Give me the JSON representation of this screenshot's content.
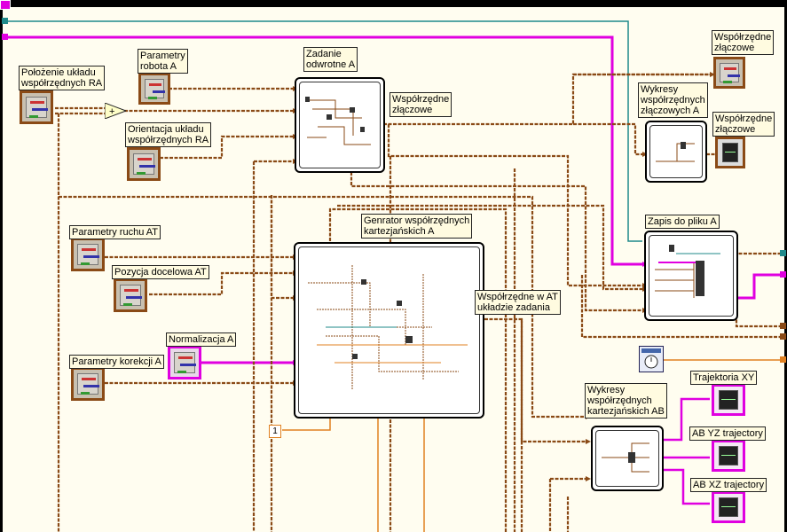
{
  "window": {
    "title": ""
  },
  "labels": {
    "polozenie": "Położenie układu\nwspółrzędnych RA",
    "parametry_robota": "Parametry\nrobota A",
    "orientacja": "Orientacja układu\nwspółrzędnych RA",
    "zadanie_odwrotne": "Zadanie\nodwrotne A",
    "wspolrzedne_zlaczowe_mid": "Współrzędne\nzłączowe",
    "wspolrzedne_zlaczowe_top": "Współrzędne\nzłączowe",
    "wykresy_zlaczowych": "Wykresy\nwspółrzędnych\nzłączowych A",
    "wspolrzedne_zlaczowe_graph": "Współrzędne\nzłączowe",
    "zapis_do_pliku": "Zapis do pliku A",
    "parametry_ruchu": "Parametry ruchu AT",
    "pozycja_docelowa": "Pozycja docelowa AT",
    "generator": "Genrator współrzędnych\nkartezjańskich A",
    "wspolrzedne_w_at": "Współrzędne w AT\nukładzie zadania",
    "normalizacja": "Normalizacja A",
    "parametry_korekcji": "Parametry korekcji A",
    "wykresy_kartezjanskich": "Wykresy\nwspółrzędnych\nkartezjańskich AB",
    "trajektoria_xy": "Trajektoria XY",
    "ab_yz": "AB YZ trajectory",
    "ab_xz": "AB XZ trajectory",
    "constant_value": "1",
    "timer_caption": "Ø/Ø"
  },
  "colors": {
    "background": "#fffdf0",
    "frame": "#000000",
    "cluster_wire": "#8a4a16",
    "string_wire": "#e000e0",
    "numeric_wire": "#e08020",
    "teal_wire": "#1f8a8a"
  },
  "icons": {
    "add_node": "add-icon",
    "timer": "stopwatch-icon",
    "control_cluster": "cluster-control-icon",
    "graph_indicator": "graph-indicator-icon"
  }
}
